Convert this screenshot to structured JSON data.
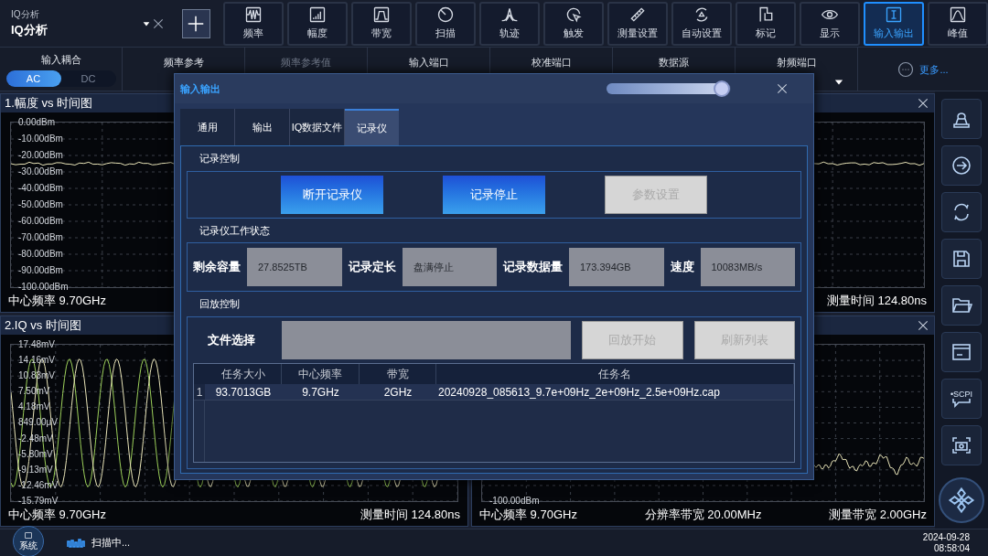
{
  "app_selector": {
    "caption": "IQ分析",
    "value": "IQ分析"
  },
  "toolbar": [
    {
      "label": "频率",
      "selected": false
    },
    {
      "label": "幅度",
      "selected": false
    },
    {
      "label": "带宽",
      "selected": false
    },
    {
      "label": "扫描",
      "selected": false
    },
    {
      "label": "轨迹",
      "selected": false
    },
    {
      "label": "触发",
      "selected": false
    },
    {
      "label": "测量设置",
      "selected": false
    },
    {
      "label": "自动设置",
      "selected": false
    },
    {
      "label": "标记",
      "selected": false
    },
    {
      "label": "显示",
      "selected": false
    },
    {
      "label": "输入输出",
      "selected": true
    },
    {
      "label": "峰值",
      "selected": false
    }
  ],
  "settings_bar": [
    {
      "kind": "toggle",
      "label": "输入耦合",
      "options": [
        {
          "label": "AC",
          "selected": true
        },
        {
          "label": "DC",
          "selected": false
        }
      ]
    },
    {
      "kind": "dropdown",
      "label": "频率参考",
      "disabled": false
    },
    {
      "kind": "dropdown",
      "label": "频率参考值",
      "disabled": true
    },
    {
      "kind": "dropdown",
      "label": "输入端口",
      "disabled": false
    },
    {
      "kind": "dropdown",
      "label": "校准端口",
      "disabled": false
    },
    {
      "kind": "dropdown",
      "label": "数据源",
      "disabled": false
    },
    {
      "kind": "dropdown",
      "label": "射频端口",
      "disabled": false
    },
    {
      "kind": "more",
      "label": "更多..."
    }
  ],
  "panels": [
    {
      "kind": "amplitude",
      "title": "1.幅度 vs 时间图",
      "y_labels": [
        "0.00dBm",
        "-10.00dBm",
        "-20.00dBm",
        "-30.00dBm",
        "-40.00dBm",
        "-50.00dBm",
        "-60.00dBm",
        "-70.00dBm",
        "-80.00dBm",
        "-90.00dBm",
        "-100.00dBm"
      ],
      "footer": [
        "中心频率 9.70GHz",
        "测量时间 124.80ns"
      ]
    },
    {
      "kind": "iq",
      "title": "2.IQ vs 时间图",
      "y_labels": [
        "17.48mV",
        "14.16mV",
        "10.83mV",
        "7.50mV",
        "4.18mV",
        "849.00μV",
        "-2.48mV",
        "-5.80mV",
        "-9.13mV",
        "-12.46mV",
        "-15.79mV"
      ],
      "footer": [
        "中心频率 9.70GHz",
        "测量时间 124.80ns"
      ]
    },
    {
      "kind": "spectrum",
      "y_labels": [
        "-100.00dBm"
      ],
      "footer": [
        "中心频率 9.70GHz",
        "分辨率带宽 20.00MHz",
        "测量带宽 2.00GHz"
      ]
    }
  ],
  "side_toolbar": {
    "scpi_label": "•SCPI"
  },
  "dialog": {
    "title": "输入输出",
    "opacity_slider": {
      "level": 0.93
    },
    "tabs": [
      {
        "label": "通用",
        "selected": false
      },
      {
        "label": "输出",
        "selected": false
      },
      {
        "label": "IQ数据文件",
        "selected": false
      },
      {
        "label": "记录仪",
        "selected": true
      }
    ],
    "record_control": {
      "title": "记录控制",
      "buttons": [
        {
          "label": "断开记录仪",
          "disabled": false
        },
        {
          "label": "记录停止",
          "disabled": false
        },
        {
          "label": "参数设置",
          "disabled": true
        }
      ]
    },
    "recorder_status": {
      "title": "记录仪工作状态",
      "fields": [
        {
          "label": "剩余容量",
          "value": "27.8525TB"
        },
        {
          "label": "记录定长",
          "value": "盘满停止"
        },
        {
          "label": "记录数据量",
          "value": "173.394GB"
        },
        {
          "label": "速度",
          "value": "10083MB/s"
        }
      ]
    },
    "playback": {
      "title": "回放控制",
      "file_label": "文件选择",
      "buttons": [
        {
          "label": "回放开始",
          "disabled": true
        },
        {
          "label": "刷新列表",
          "disabled": true
        }
      ],
      "table": {
        "columns": [
          "任务大小",
          "中心频率",
          "带宽",
          "任务名"
        ],
        "rows": [
          {
            "index": "1",
            "cells": [
              "93.7013GB",
              "9.7GHz",
              "2GHz",
              "20240928_085613_9.7e+09Hz_2e+09Hz_2.5e+09Hz.cap"
            ]
          }
        ]
      }
    }
  },
  "status_bar": {
    "system_button": "系统",
    "scan_status": "扫描中...",
    "date": "2024-09-28",
    "time": "08:58:04"
  }
}
